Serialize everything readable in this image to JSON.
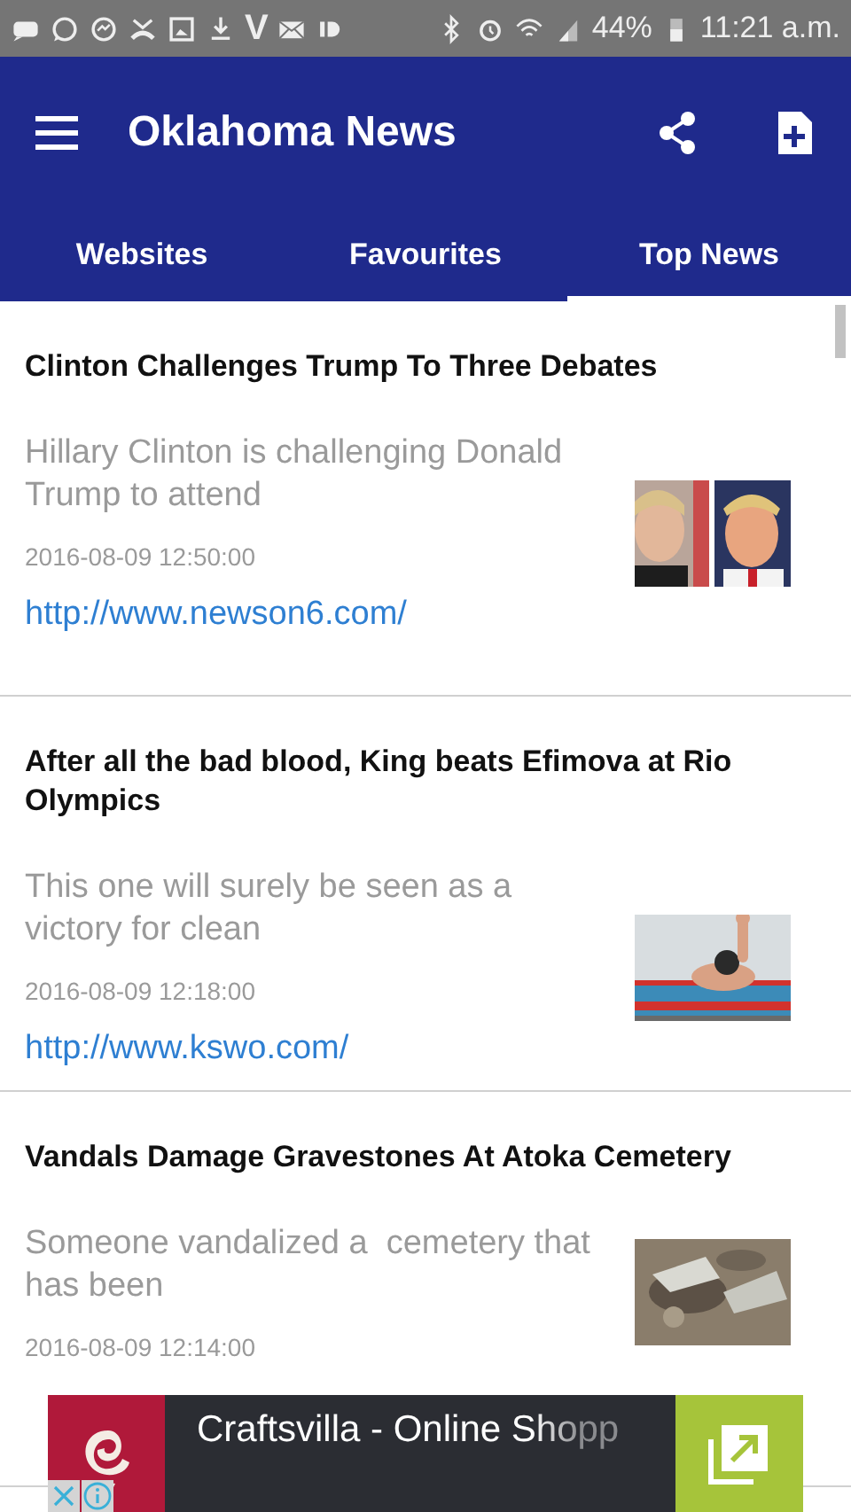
{
  "status_bar": {
    "left_glyph": "V",
    "battery": "44%",
    "time": "11:21 a.m."
  },
  "app_bar": {
    "title": "Oklahoma News"
  },
  "tabs": [
    {
      "label": "Websites",
      "selected": false
    },
    {
      "label": "Favourites",
      "selected": false
    },
    {
      "label": "Top News",
      "selected": true
    }
  ],
  "articles": [
    {
      "title": "Clinton Challenges Trump To Three Debates",
      "summary": "Hillary Clinton is challenging Donald Trump to attend",
      "date": "2016-08-09 12:50:00",
      "url": "http://www.newson6.com/"
    },
    {
      "title": "After all the bad blood, King beats Efimova at Rio Olympics",
      "summary": "This one will surely be seen as a victory for clean",
      "date": "2016-08-09 12:18:00",
      "url": "http://www.kswo.com/"
    },
    {
      "title": "Vandals Damage Gravestones At Atoka Cemetery",
      "summary": "Someone vandalized a  cemetery that has been",
      "date": "2016-08-09 12:14:00"
    }
  ],
  "ad": {
    "text": "Craftsvilla - Online Shopp"
  }
}
